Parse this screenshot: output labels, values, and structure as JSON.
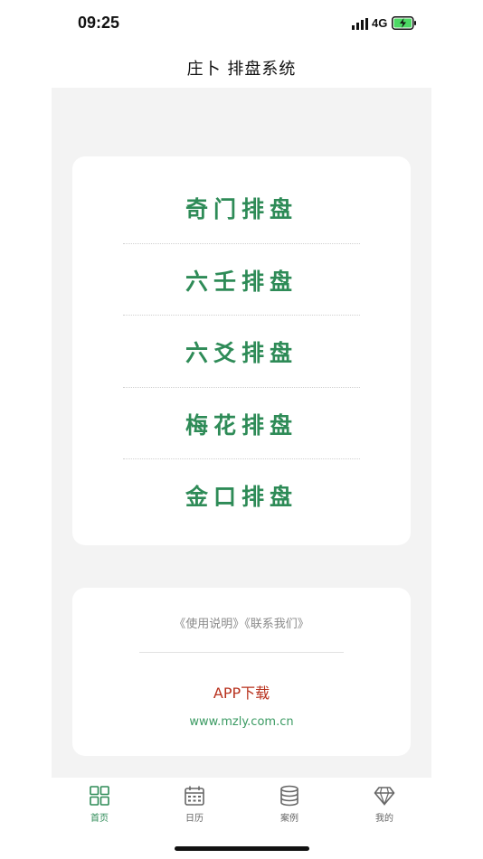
{
  "status_bar": {
    "time": "09:25",
    "network": "4G",
    "icons": [
      "signal-icon",
      "battery-charging-icon"
    ]
  },
  "nav": {
    "title": "庄卜 排盘系统"
  },
  "menu": {
    "items": [
      {
        "label": "奇门排盘"
      },
      {
        "label": "六壬排盘"
      },
      {
        "label": "六爻排盘"
      },
      {
        "label": "梅花排盘"
      },
      {
        "label": "金口排盘"
      }
    ]
  },
  "info": {
    "usage_link": "《使用说明》",
    "contact_link": "《联系我们》",
    "app_download": "APP下载",
    "website": "www.mzly.com.cn"
  },
  "tabs": [
    {
      "label": "首页",
      "icon": "grid-home-icon",
      "active": true
    },
    {
      "label": "日历",
      "icon": "calendar-icon",
      "active": false
    },
    {
      "label": "案例",
      "icon": "database-stack-icon",
      "active": false
    },
    {
      "label": "我的",
      "icon": "diamond-icon",
      "active": false
    }
  ],
  "colors": {
    "accent_green": "#2e8b57",
    "download_red": "#b8321e",
    "background_gray": "#f3f3f3"
  }
}
